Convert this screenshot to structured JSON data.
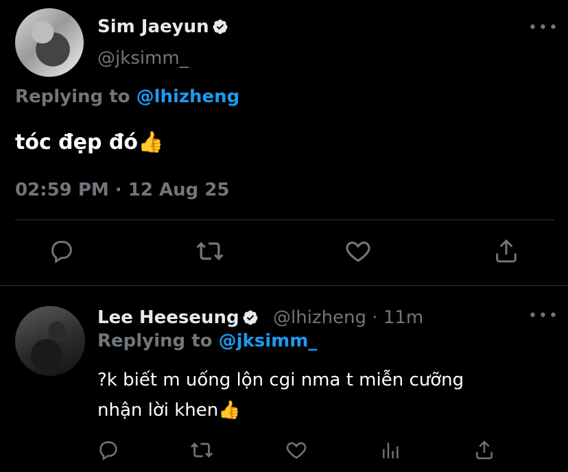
{
  "tweet1": {
    "author_name": "Sim Jaeyun",
    "handle": "@jksimm_",
    "replying_prefix": "Replying to ",
    "replying_to": "@lhizheng",
    "text": "tóc đẹp đó👍",
    "timestamp": "02:59 PM · 12 Aug 25",
    "more_label": "•••"
  },
  "tweet2": {
    "author_name": "Lee Heeseung",
    "handle_time": "@lhizheng · 11m",
    "replying_prefix": "Replying to ",
    "replying_to": "@jksimm_",
    "text_line1": "?k biết m uống lộn cgi nma t miễn cưỡng",
    "text_line2": "nhận lời khen👍",
    "more_label": "•••"
  },
  "colors": {
    "background": "#000000",
    "text": "#e7e9ea",
    "muted": "#71767b",
    "accent": "#1d9bf0",
    "divider": "#2f3336"
  },
  "icons": [
    "reply-icon",
    "retweet-icon",
    "like-icon",
    "share-icon",
    "analytics-icon",
    "verified-badge-icon",
    "more-options-icon"
  ]
}
